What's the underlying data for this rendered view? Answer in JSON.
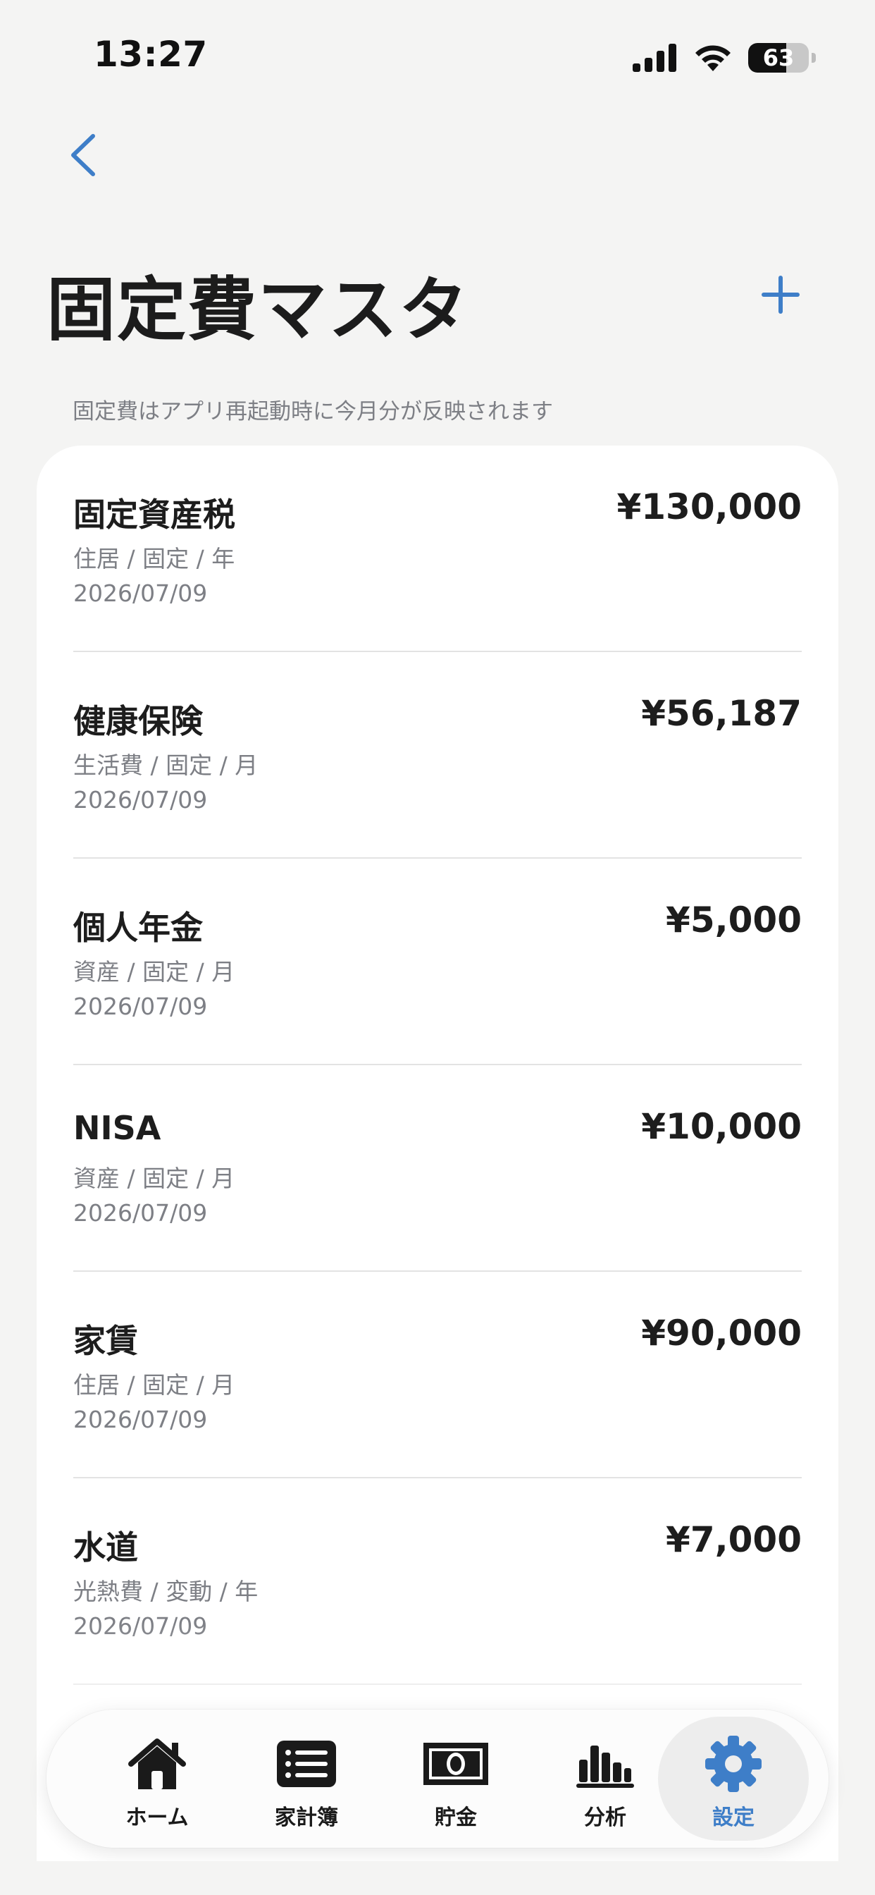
{
  "status_bar": {
    "time": "13:27",
    "battery": "63",
    "battery_level": 0.63,
    "icons": [
      "cellular-signal-icon",
      "wifi-icon",
      "battery-icon"
    ]
  },
  "nav": {
    "back_icon": "chevron-left-icon",
    "add_icon": "plus-icon"
  },
  "page": {
    "title": "固定費マスタ",
    "subtitle": "固定費はアプリ再起動時に今月分が反映されます"
  },
  "items": [
    {
      "name": "固定資産税",
      "meta": "住居 / 固定 / 年",
      "date": "2026/07/09",
      "amount": "¥130,000"
    },
    {
      "name": "健康保険",
      "meta": "生活費 / 固定 / 月",
      "date": "2026/07/09",
      "amount": "¥56,187"
    },
    {
      "name": "個人年金",
      "meta": "資産 / 固定 / 月",
      "date": "2026/07/09",
      "amount": "¥5,000"
    },
    {
      "name": "NISA",
      "meta": "資産 / 固定 / 月",
      "date": "2026/07/09",
      "amount": "¥10,000"
    },
    {
      "name": "家賃",
      "meta": "住居 / 固定 / 月",
      "date": "2026/07/09",
      "amount": "¥90,000"
    },
    {
      "name": "水道",
      "meta": "光熱費 / 変動 / 年",
      "date": "2026/07/09",
      "amount": "¥7,000"
    }
  ],
  "tabbar": {
    "tabs": [
      {
        "label": "ホーム",
        "icon": "house-icon"
      },
      {
        "label": "家計簿",
        "icon": "list-icon"
      },
      {
        "label": "貯金",
        "icon": "banknote-icon"
      },
      {
        "label": "分析",
        "icon": "bar-chart-icon"
      },
      {
        "label": "設定",
        "icon": "gear-icon",
        "active": true
      }
    ]
  },
  "colors": {
    "accent": "#3e7ec8",
    "background": "#f4f4f3",
    "card": "#ffffff",
    "secondary_text": "#7d7f85"
  }
}
